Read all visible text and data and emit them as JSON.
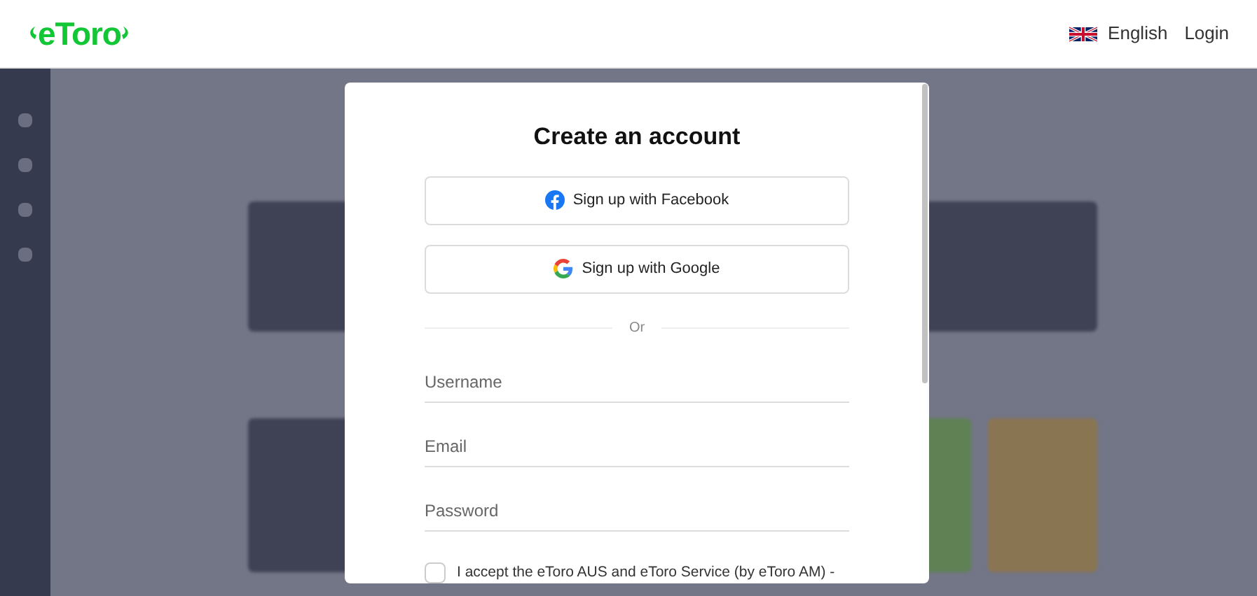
{
  "header": {
    "logo": "eToro",
    "language": "English",
    "login": "Login"
  },
  "dialog": {
    "title": "Create an account",
    "social_buttons": [
      {
        "kind": "facebook",
        "label": "Sign up with Facebook"
      },
      {
        "kind": "google",
        "label": "Sign up with Google"
      }
    ],
    "divider": "Or",
    "fields": [
      {
        "placeholder": "Username"
      },
      {
        "placeholder": "Email"
      },
      {
        "placeholder": "Password"
      }
    ],
    "terms": {
      "checked": false,
      "text": "I accept the eToro AUS and eToro Service (by eToro AM) -"
    }
  }
}
